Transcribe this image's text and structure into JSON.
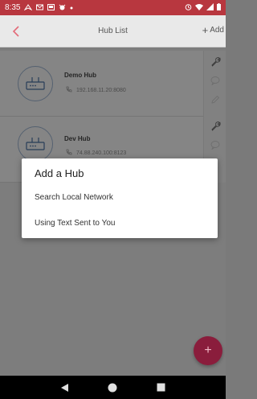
{
  "status_bar": {
    "time": "8:35",
    "left_icons": [
      "navigation-icon",
      "mail-icon",
      "cast-icon",
      "bug-icon",
      "dot-icon"
    ],
    "right_icons": [
      "alarm-icon",
      "wifi-icon",
      "signal-icon",
      "battery-icon"
    ]
  },
  "app_bar": {
    "title": "Hub List",
    "add_label": "Add",
    "add_plus": "+"
  },
  "hubs": [
    {
      "name": "Demo Hub",
      "address": "192.168.11.20:8080"
    },
    {
      "name": "Dev Hub",
      "address": "74.88.240.100:8123"
    }
  ],
  "dialog": {
    "title": "Add a Hub",
    "options": [
      "Search Local Network",
      "Using Text Sent to You"
    ]
  },
  "fab": {
    "label": "+"
  },
  "colors": {
    "accent": "#e36a78",
    "status_bar": "#b8373f",
    "fab": "#8a1d3c"
  }
}
